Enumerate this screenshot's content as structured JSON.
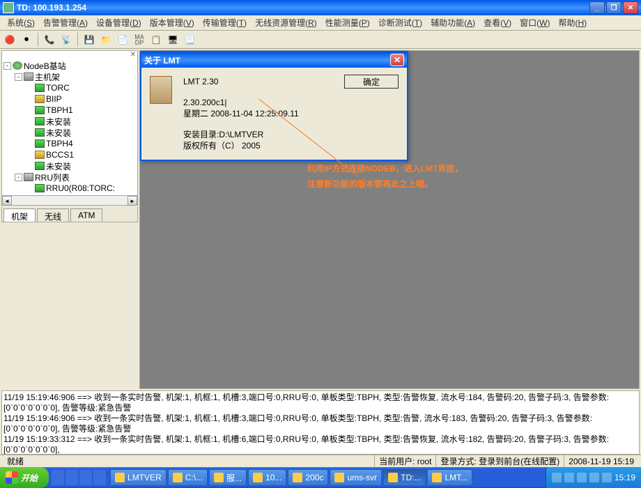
{
  "window": {
    "title": "TD: 100.193.1.254"
  },
  "menu": [
    {
      "label": "系统",
      "key": "S"
    },
    {
      "label": "告警管理",
      "key": "A"
    },
    {
      "label": "设备管理",
      "key": "D"
    },
    {
      "label": "版本管理",
      "key": "V"
    },
    {
      "label": "传输管理",
      "key": "T"
    },
    {
      "label": "无线资源管理",
      "key": "R"
    },
    {
      "label": "性能测量",
      "key": "P"
    },
    {
      "label": "诊断测试",
      "key": "T"
    },
    {
      "label": "辅助功能",
      "key": "A"
    },
    {
      "label": "查看",
      "key": "V"
    },
    {
      "label": "窗口",
      "key": "W"
    },
    {
      "label": "帮助",
      "key": "H"
    }
  ],
  "tree": {
    "root": "NodeB基站",
    "sub": "主机架",
    "cards": [
      "TORC",
      "BIIP",
      "TBPH1",
      "未安装",
      "未安装",
      "TBPH4",
      "BCCS1",
      "未安装"
    ],
    "rru_list": "RRU列表",
    "rru": "RRU0(R08:TORC:"
  },
  "tree_tabs": [
    "机架",
    "无线",
    "ATM"
  ],
  "dialog": {
    "title": "关于 LMT",
    "product": "LMT 2.30",
    "version": "2.30.200c1|",
    "build": "星期二 2008-11-04 12:25:09.11",
    "install": "安装目录:D:\\LMTVER",
    "copyright": "版权所有（C） 2005",
    "ok": "确定"
  },
  "annotation": {
    "l1": "利用IP方式连接NODEB，进入LMT界面，",
    "l2": "注意新功能的版本要再此之上哦。"
  },
  "log": [
    "11/19 15:19:46:906 ==> 收到一条实时告警, 机架:1, 机框:1, 机槽:3,端口号:0,RRU号:0, 单板类型:TBPH, 类型:告警恢复, 流水号:184, 告警码:20, 告警子码:3, 告警参数:[0`0`0`0`0`0`0], 告警等级:紧急告警",
    "11/19 15:19:46:906 ==> 收到一条实时告警, 机架:1, 机框:1, 机槽:3,端口号:0,RRU号:0, 单板类型:TBPH, 类型:告警, 流水号:183, 告警码:20, 告警子码:3, 告警参数:[0`0`0`0`0`0`0], 告警等级:紧急告警",
    "11/19 15:19:33:312 ==> 收到一条实时告警, 机架:1, 机框:1, 机槽:6,端口号:0,RRU号:0, 单板类型:TBPH, 类型:告警恢复, 流水号:182, 告警码:20, 告警子码:3, 告警参数:[0`0`0`0`0`0`0],"
  ],
  "status": {
    "ready": "就绪",
    "user_lbl": "当前用户:",
    "user": "root",
    "login_lbl": "登录方式:",
    "login": "登录到前台(在线配置)",
    "time": "2008-11-19 15:19"
  },
  "taskbar": {
    "start": "开始",
    "tasks": [
      "LMTVER",
      "C:\\...",
      "服...",
      "10...",
      "200c",
      "ums-svr",
      "TD:...",
      "LMT..."
    ],
    "clock": "15:19"
  }
}
